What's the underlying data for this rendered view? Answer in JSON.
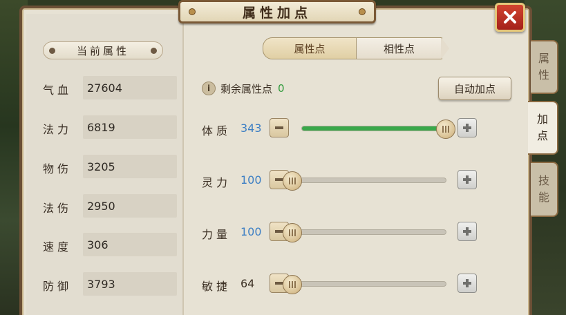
{
  "window": {
    "title": "属性加点"
  },
  "left_panel": {
    "section_title": "当前属性",
    "stats": [
      {
        "name": "气血",
        "value": "27604"
      },
      {
        "name": "法力",
        "value": "6819"
      },
      {
        "name": "物伤",
        "value": "3205"
      },
      {
        "name": "法伤",
        "value": "2950"
      },
      {
        "name": "速度",
        "value": "306"
      },
      {
        "name": "防御",
        "value": "3793"
      }
    ]
  },
  "tabs": {
    "active": "属性点",
    "inactive": "相性点"
  },
  "points": {
    "info_glyph": "i",
    "label": "剩余属性点",
    "value": "0"
  },
  "auto_button": "自动加点",
  "attributes": {
    "items": [
      {
        "name": "体质",
        "value": "343",
        "level": 1.0
      },
      {
        "name": "灵力",
        "value": "100",
        "level": 0.0
      },
      {
        "name": "力量",
        "value": "100",
        "level": 0.0
      },
      {
        "name": "敏捷",
        "value": "64",
        "level": 0.0
      }
    ]
  },
  "side_tabs": [
    {
      "label": "属性",
      "active": false
    },
    {
      "label": "加点",
      "active": true
    },
    {
      "label": "技能",
      "active": false
    }
  ],
  "colors": {
    "frame": "#6b4f35",
    "close": "#c0392b",
    "progress": "#39a84a",
    "points_value": "#2e9a3a",
    "attr_value": "#3d7fc4"
  },
  "icons": {
    "close": "close-icon",
    "info": "info-icon",
    "minus": "minus-icon",
    "plus": "plus-icon",
    "slider": "slider-knob-icon"
  }
}
